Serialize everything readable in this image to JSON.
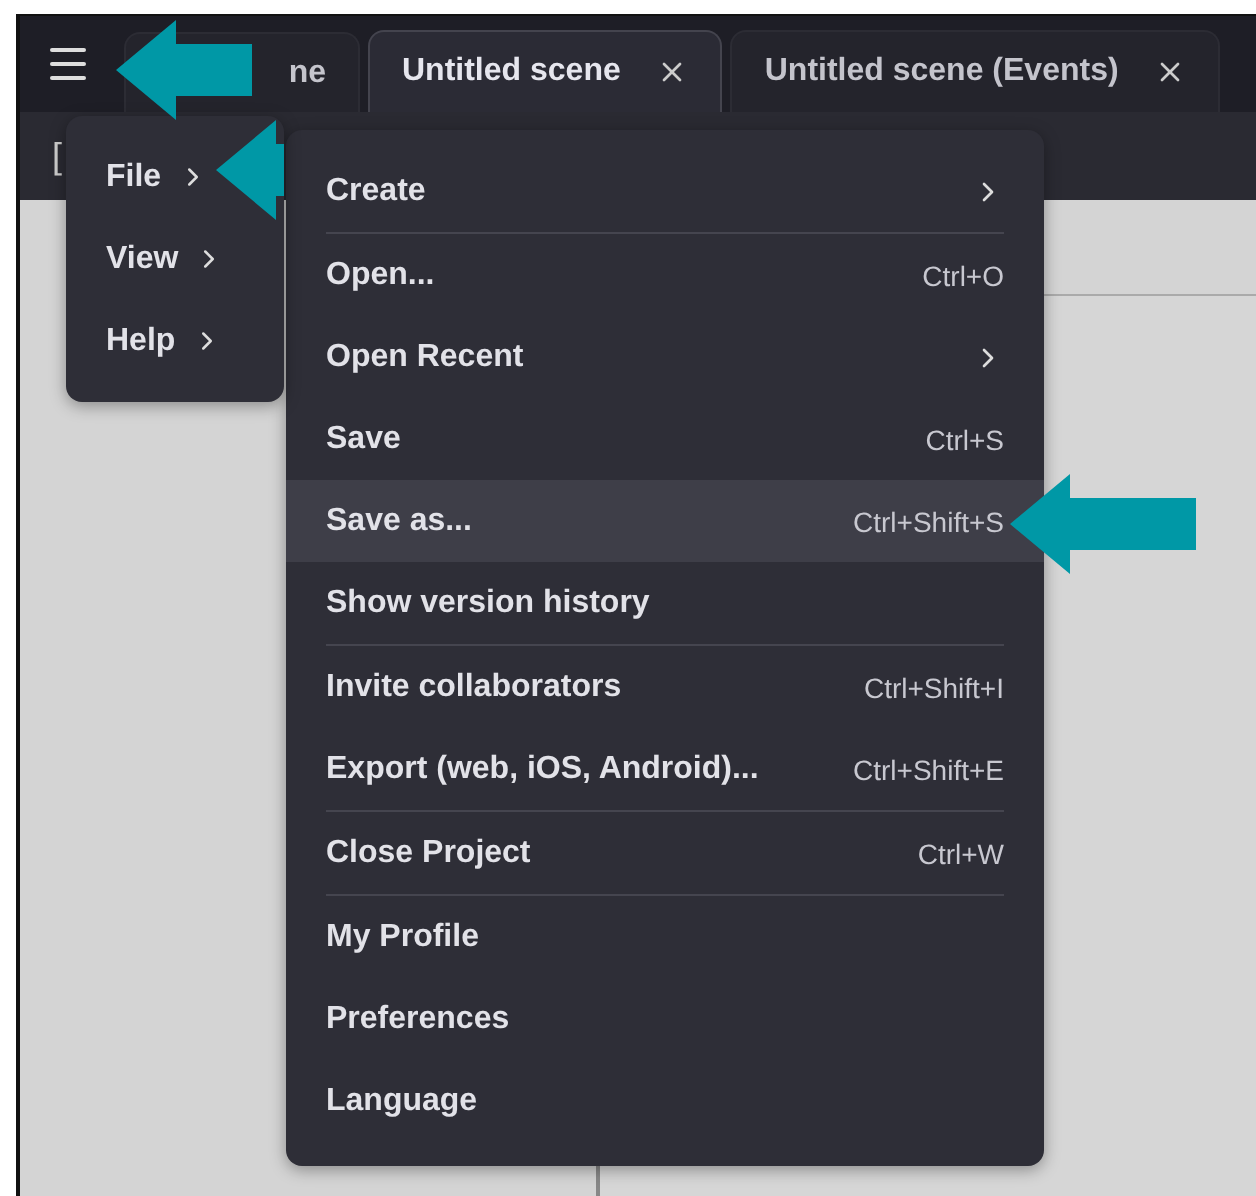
{
  "tabs": [
    {
      "label": "ne",
      "selected": false,
      "closable": false
    },
    {
      "label": "Untitled scene",
      "selected": true,
      "closable": true
    },
    {
      "label": "Untitled scene (Events)",
      "selected": false,
      "closable": true
    }
  ],
  "toolbar": {
    "fragment": "["
  },
  "main_menu": {
    "items": [
      {
        "label": "File",
        "has_submenu": true
      },
      {
        "label": "View",
        "has_submenu": true
      },
      {
        "label": "Help",
        "has_submenu": true
      }
    ]
  },
  "file_menu": {
    "items": [
      {
        "kind": "item",
        "label": "Create",
        "has_submenu": true,
        "selected": false
      },
      {
        "kind": "divider"
      },
      {
        "kind": "item",
        "label": "Open...",
        "shortcut": "Ctrl+O",
        "has_submenu": false,
        "selected": false
      },
      {
        "kind": "item",
        "label": "Open Recent",
        "has_submenu": true,
        "selected": false
      },
      {
        "kind": "item",
        "label": "Save",
        "shortcut": "Ctrl+S",
        "has_submenu": false,
        "selected": false
      },
      {
        "kind": "item",
        "label": "Save as...",
        "shortcut": "Ctrl+Shift+S",
        "has_submenu": false,
        "selected": true
      },
      {
        "kind": "item",
        "label": "Show version history",
        "has_submenu": false,
        "selected": false
      },
      {
        "kind": "divider"
      },
      {
        "kind": "item",
        "label": "Invite collaborators",
        "shortcut": "Ctrl+Shift+I",
        "has_submenu": false,
        "selected": false
      },
      {
        "kind": "item",
        "label": "Export (web, iOS, Android)...",
        "shortcut": "Ctrl+Shift+E",
        "has_submenu": false,
        "selected": false
      },
      {
        "kind": "divider"
      },
      {
        "kind": "item",
        "label": "Close Project",
        "shortcut": "Ctrl+W",
        "has_submenu": false,
        "selected": false
      },
      {
        "kind": "divider"
      },
      {
        "kind": "item",
        "label": "My Profile",
        "has_submenu": false,
        "selected": false
      },
      {
        "kind": "item",
        "label": "Preferences",
        "has_submenu": false,
        "selected": false
      },
      {
        "kind": "item",
        "label": "Language",
        "has_submenu": false,
        "selected": false
      }
    ]
  }
}
